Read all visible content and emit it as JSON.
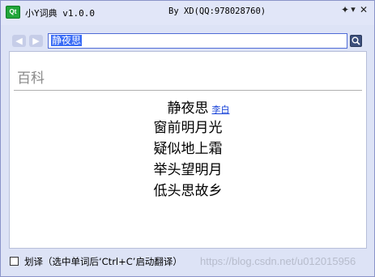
{
  "window": {
    "icon_text": "Qt",
    "title": "小Y词典 v1.0.0",
    "author": "By XD(QQ:978028760)"
  },
  "titlebar_buttons": {
    "settings_icon": "gear-arrow-icon",
    "minimize_icon": "minimize-icon",
    "close_icon": "close-icon",
    "settings_glyph": "✦",
    "minimize_glyph": "▾",
    "close_glyph": "✕"
  },
  "nav": {
    "back_glyph": "◀",
    "forward_glyph": "▶"
  },
  "search": {
    "value": "静夜思",
    "icon": "search-icon"
  },
  "content": {
    "section_title": "百科",
    "poem": {
      "title": "静夜思",
      "author": "李白",
      "lines": [
        "窗前明月光",
        "疑似地上霜",
        "举头望明月",
        "低头思故乡"
      ]
    }
  },
  "status": {
    "checkbox_checked": false,
    "hint": "划译（选中单词后‘Ctrl+C’启动翻译）",
    "watermark": "https://blog.csdn.net/u012015956"
  },
  "colors": {
    "window_bg": "#dde3f6",
    "input_border": "#4f6bd6",
    "selection": "#3a6cf6",
    "link": "#1a44d8"
  }
}
